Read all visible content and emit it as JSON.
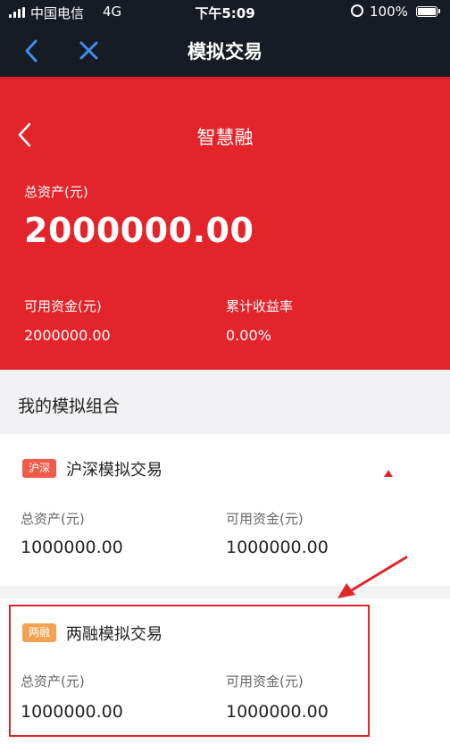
{
  "status_bar": {
    "carrier": "中国电信",
    "network": "4G",
    "time": "下午5:09",
    "battery": "100%"
  },
  "nav": {
    "title": "模拟交易"
  },
  "hero": {
    "title": "智慧融",
    "total_assets_label": "总资产(元)",
    "total_assets_value": "2000000.00",
    "available_funds_label": "可用资金(元)",
    "available_funds_value": "2000000.00",
    "cumulative_return_label": "累计收益率",
    "cumulative_return_value": "0.00%"
  },
  "section": {
    "title": "我的模拟组合"
  },
  "portfolios": [
    {
      "badge": "沪深",
      "name": "沪深模拟交易",
      "total_assets_label": "总资产(元)",
      "total_assets_value": "1000000.00",
      "available_funds_label": "可用资金(元)",
      "available_funds_value": "1000000.00"
    },
    {
      "badge": "两融",
      "name": "两融模拟交易",
      "total_assets_label": "总资产(元)",
      "total_assets_value": "1000000.00",
      "available_funds_label": "可用资金(元)",
      "available_funds_value": "1000000.00"
    }
  ],
  "colors": {
    "brand_red": "#e3242b",
    "nav_dark": "#171c24",
    "badge_red": "#f05a4a",
    "badge_orange": "#f5a152"
  }
}
